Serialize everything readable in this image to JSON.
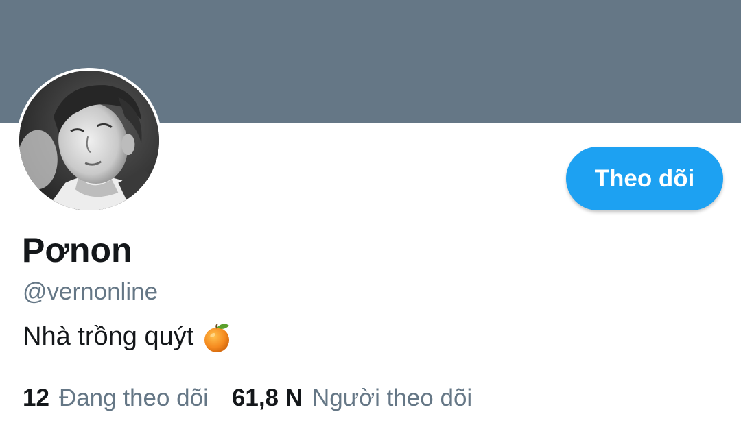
{
  "colors": {
    "banner": "#657786",
    "accent": "#1da1f2",
    "secondary_text": "#657786",
    "primary_text": "#14171a"
  },
  "profile": {
    "display_name": "Pơnon",
    "handle": "@vernonline",
    "bio": "Nhà trồng quýt",
    "bio_emoji_icon": "tangerine-icon",
    "avatar_icon": "avatar-photo"
  },
  "follow_button": {
    "label": "Theo dõi"
  },
  "stats": {
    "following": {
      "count": "12",
      "label": "Đang theo dõi"
    },
    "followers": {
      "count": "61,8 N",
      "label": "Người theo dõi"
    }
  }
}
